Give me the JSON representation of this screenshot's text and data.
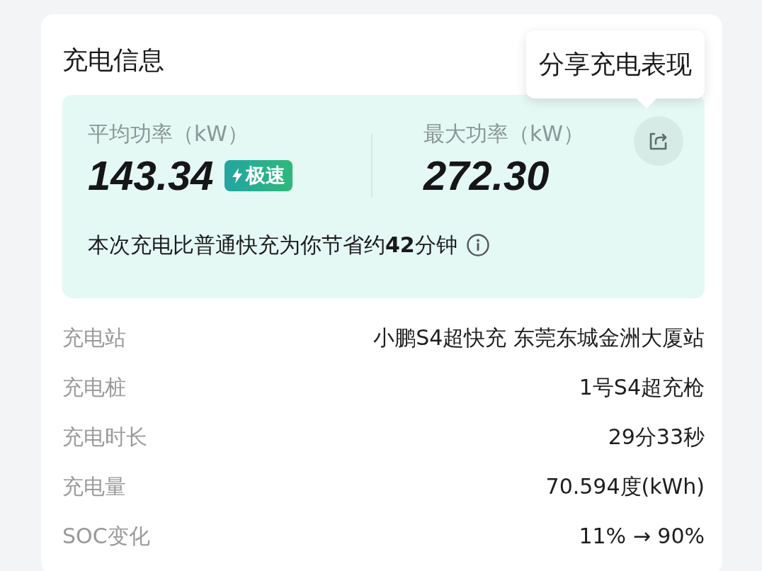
{
  "card": {
    "title": "充电信息"
  },
  "tooltip": {
    "text": "分享充电表现"
  },
  "stats": [
    {
      "label": "平均功率（kW）",
      "value": "143.34",
      "badge": "极速"
    },
    {
      "label": "最大功率（kW）",
      "value": "272.30"
    }
  ],
  "savings": {
    "text": "本次充电比普通快充为你节省约**42**分钟"
  },
  "details": [
    {
      "label": "充电站",
      "value": "小鹏S4超快充 东莞东城金洲大厦站"
    },
    {
      "label": "充电桩",
      "value": "1号S4超充枪"
    },
    {
      "label": "充电时长",
      "value": "29分33秒"
    },
    {
      "label": "充电量",
      "value": "70.594度(kWh)"
    },
    {
      "label": "SOC变化",
      "value": "11% → 90%"
    }
  ]
}
